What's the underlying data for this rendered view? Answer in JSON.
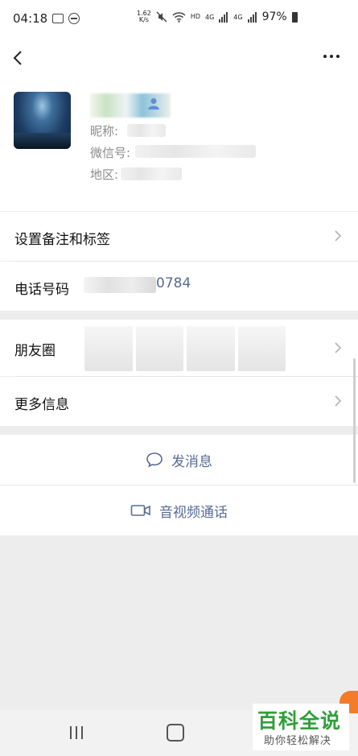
{
  "status_bar": {
    "time": "04:18",
    "net_speed_top": "1.62",
    "net_speed_bottom": "K/s",
    "hd": "HD",
    "net_1": "4G",
    "net_2": "4G",
    "battery": "97%"
  },
  "profile": {
    "nickname_label": "昵称:",
    "wechat_id_label": "微信号:",
    "region_label": "地区:"
  },
  "rows": {
    "remark": "设置备注和标签",
    "phone_label": "电话号码",
    "phone_value": "0784",
    "moments": "朋友圈",
    "more_info": "更多信息"
  },
  "actions": {
    "send_message": "发消息",
    "video_call": "音视频通话"
  },
  "watermark": {
    "title": "百科全说",
    "subtitle": "助你轻松解决"
  }
}
